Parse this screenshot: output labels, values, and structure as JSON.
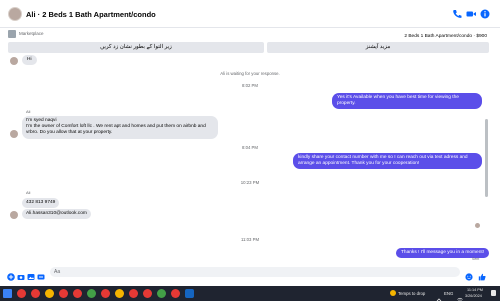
{
  "header": {
    "title": "Ali · 2 Beds 1 Bath Apartment/condo",
    "icons": [
      "phone-icon",
      "video-icon",
      "info-icon"
    ]
  },
  "listing": {
    "marketplace_label": "Marketplace",
    "detail": "2 Beds 1 Bath Apartment/condo · $900"
  },
  "quick_replies": [
    {
      "label": "مزید آپشنز"
    },
    {
      "label": "زیر التوا کے بطور نشان زد کریں"
    }
  ],
  "messages": {
    "hi": "Hi",
    "waiting": "Ali is waiting for your response.",
    "time1": "8:02 PM",
    "out1": "Yes it's Available when you have best time for viewing the property.",
    "sender_ali_1": "Ali",
    "in2": "I'm syed naqvi\n I'm the owner of Comfort loft llc . We rent apt and homes and put them on airbnb and vrbro. Do you allow that at your property.",
    "time2": "8:04 PM",
    "out2": "kindly share your contact number with me so I can reach out via text adress and arrange an appointment. Thank you for your cooperation!",
    "time3": "10:23 PM",
    "sender_ali_2": "Ali",
    "in3a": "432 813 9749",
    "in3b": "Ali.hassan310@outlook.com",
    "time4": "11:03 PM",
    "out3": "Thanks ! I'll message you in a moment!",
    "seen": "Sent"
  },
  "composer": {
    "placeholder": "Aa"
  },
  "taskbar": {
    "weather": "Temps to drop",
    "lang": "ENG",
    "time": "11:14 PM",
    "date": "3/26/2024"
  },
  "colors": {
    "outgoing_bubble": "#5b4ee9",
    "incoming_bubble": "#e4e6eb",
    "accent": "#0866ff"
  }
}
